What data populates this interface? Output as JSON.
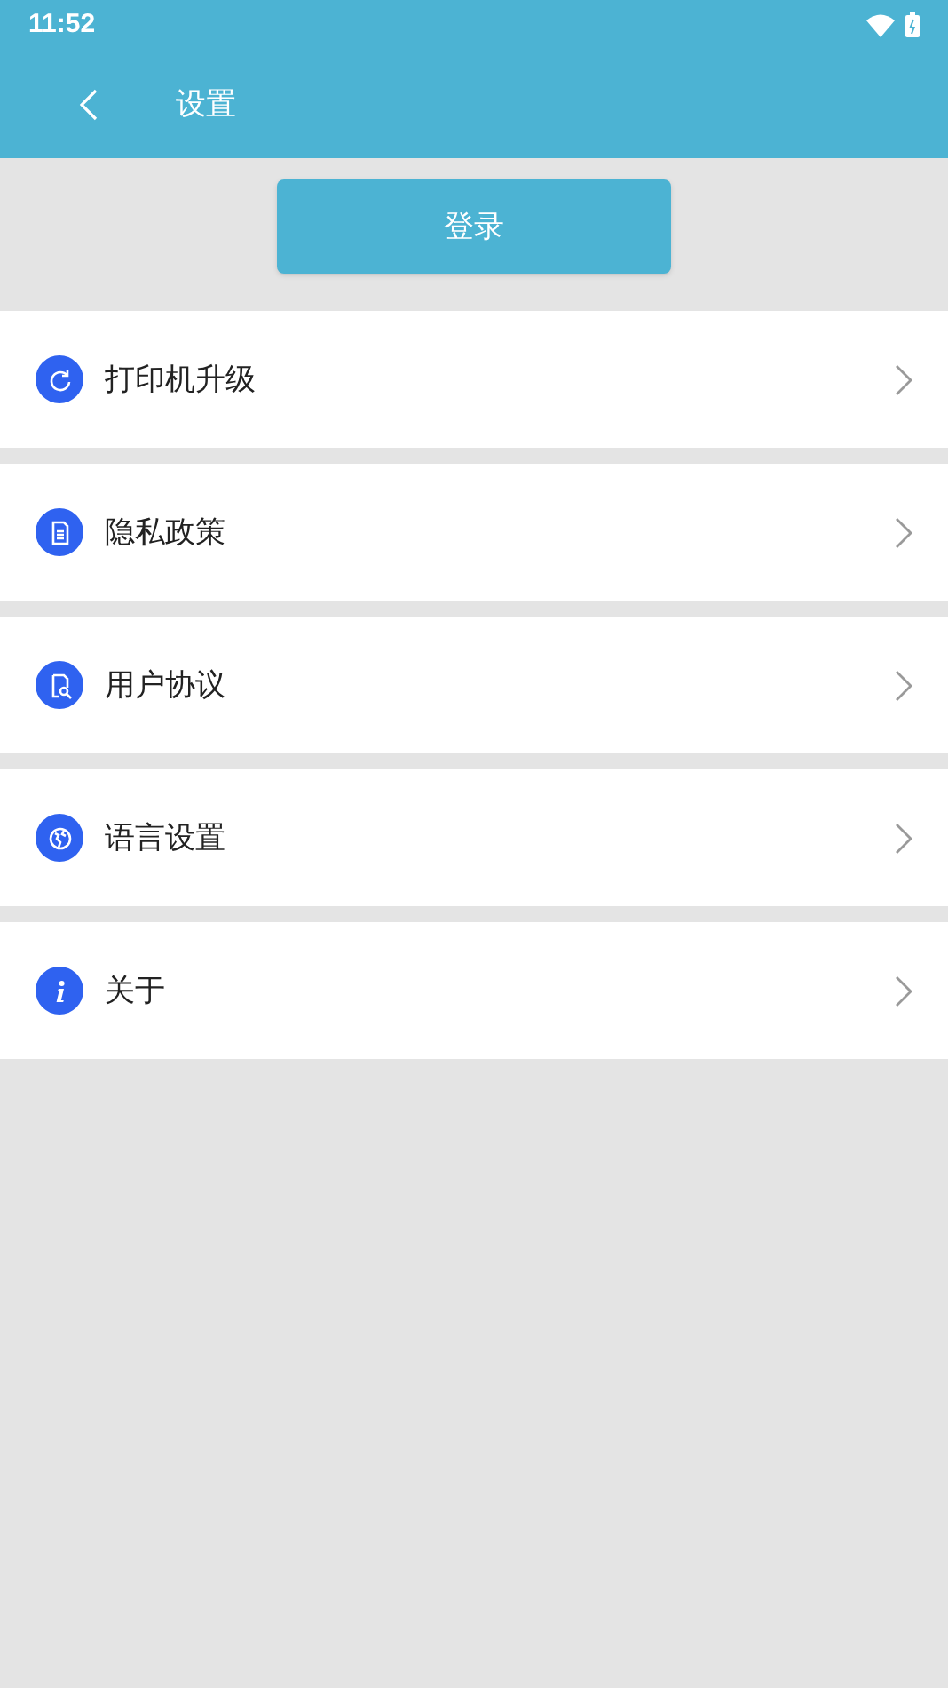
{
  "status_bar": {
    "time": "11:52"
  },
  "app_bar": {
    "title": "设置"
  },
  "login_button": {
    "label": "登录"
  },
  "menu": [
    {
      "kind": "refresh",
      "label": "打印机升级"
    },
    {
      "kind": "document",
      "label": "隐私政策"
    },
    {
      "kind": "agreement",
      "label": "用户协议"
    },
    {
      "kind": "globe",
      "label": "语言设置"
    },
    {
      "kind": "info",
      "label": "关于"
    }
  ]
}
